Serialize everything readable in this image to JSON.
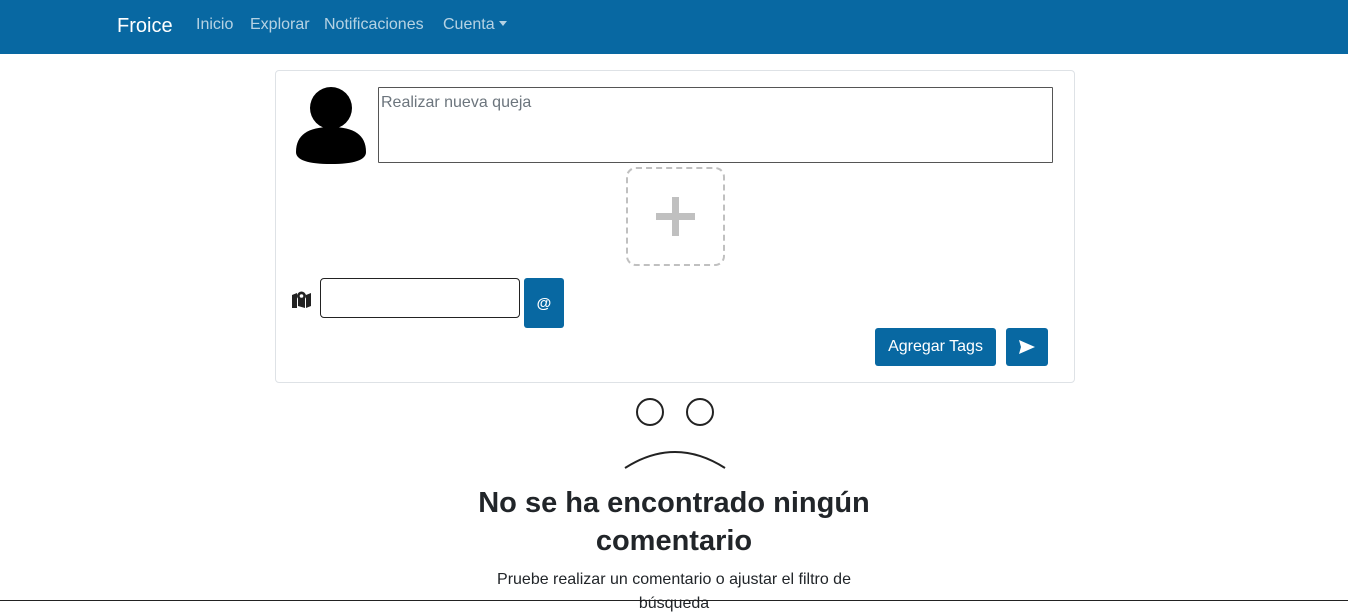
{
  "navbar": {
    "brand": "Froice",
    "items": [
      {
        "label": "Inicio"
      },
      {
        "label": "Explorar"
      },
      {
        "label": "Notificaciones"
      },
      {
        "label": "Cuenta"
      }
    ],
    "background": "#0868a2"
  },
  "composer": {
    "placeholder": "Realizar nueva queja",
    "location_value": "",
    "at_label": "@",
    "add_tags_label": "Agregar Tags",
    "avatar_icon": "user-silhouette-icon",
    "add_image_icon": "plus-icon",
    "location_icon": "map-marker-icon",
    "send_icon": "send-arrow-icon"
  },
  "empty_state": {
    "icon": "sad-face-icon",
    "title": "No se ha encontrado ningún comentario",
    "subtitle": "Pruebe realizar un comentario o ajustar el filtro de búsqueda"
  },
  "colors": {
    "accent": "#0868a2",
    "text": "#212529"
  }
}
